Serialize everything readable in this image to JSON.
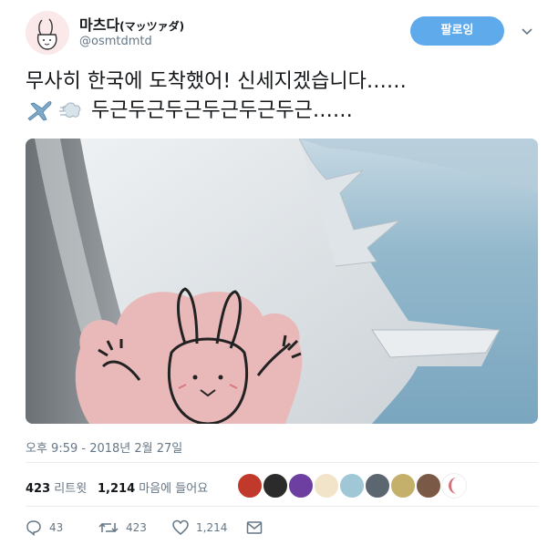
{
  "user": {
    "display_name": "마츠다",
    "display_name_kana": "(マッツァダ)",
    "handle": "@osmtdmtd"
  },
  "follow_button": {
    "label": "팔로잉"
  },
  "tweet": {
    "line1": "무사히 한국에 도착했어! 신세지겠습니다……",
    "line2": "두근두근두근두근두근두근……",
    "emoji": [
      "airplane-icon",
      "dash-icon"
    ]
  },
  "timestamp": "오후 9:59 - 2018년 2월 27일",
  "stats": {
    "retweets_count": "423",
    "retweets_label": "리트윗",
    "likes_count": "1,214",
    "likes_label": "마음에 들어요"
  },
  "actions": {
    "reply_count": "43",
    "retweet_count": "423",
    "like_count": "1,214"
  },
  "colors": {
    "follow_button": "#5eaaeb",
    "secondary_text": "#657786",
    "divider": "#e6ecf0"
  }
}
